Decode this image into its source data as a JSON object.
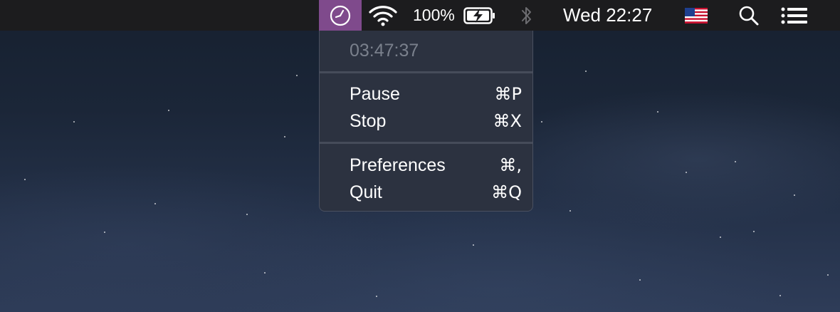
{
  "menubar": {
    "battery_percent": "100%",
    "clock": "Wed 22:27",
    "icons": {
      "timer": "clock-icon",
      "wifi": "wifi-icon",
      "battery": "battery-charging-icon",
      "bluetooth": "bluetooth-icon",
      "input_source": "us-flag-icon",
      "search": "search-icon",
      "notifications": "list-icon"
    },
    "active_item_color": "#7f4a8c"
  },
  "menu": {
    "elapsed_time": "03:47:37",
    "items": [
      {
        "label": "Pause",
        "shortcut": "⌘P"
      },
      {
        "label": "Stop",
        "shortcut": "⌘X"
      },
      {
        "label": "Preferences",
        "shortcut": "⌘,"
      },
      {
        "label": "Quit",
        "shortcut": "⌘Q"
      }
    ]
  }
}
